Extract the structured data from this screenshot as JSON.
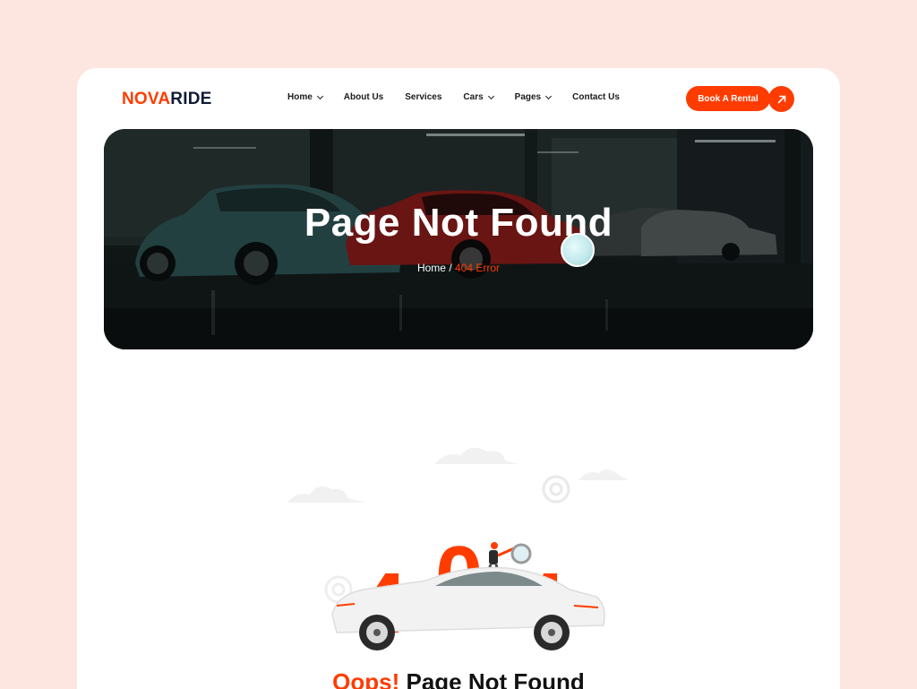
{
  "brand": {
    "part1": "NOVA",
    "part2": "RIDE"
  },
  "nav": {
    "items": [
      {
        "label": "Home",
        "has_dropdown": true
      },
      {
        "label": "About Us",
        "has_dropdown": false
      },
      {
        "label": "Services",
        "has_dropdown": false
      },
      {
        "label": "Cars",
        "has_dropdown": true
      },
      {
        "label": "Pages",
        "has_dropdown": true
      },
      {
        "label": "Contact Us",
        "has_dropdown": false
      }
    ]
  },
  "header": {
    "cta_label": "Book A Rental",
    "cta_icon": "arrow-up-right-icon"
  },
  "hero": {
    "title": "Page Not Found",
    "breadcrumb_home": "Home",
    "breadcrumb_sep": "/",
    "breadcrumb_current": "404 Error"
  },
  "error": {
    "code_digits": [
      "4",
      "0",
      "4"
    ],
    "headline_accent": "Oops!",
    "headline_rest": "Page Not Found"
  },
  "colors": {
    "accent": "#ff3c00",
    "page_bg": "#fde6df",
    "navy": "#0e1b33"
  }
}
